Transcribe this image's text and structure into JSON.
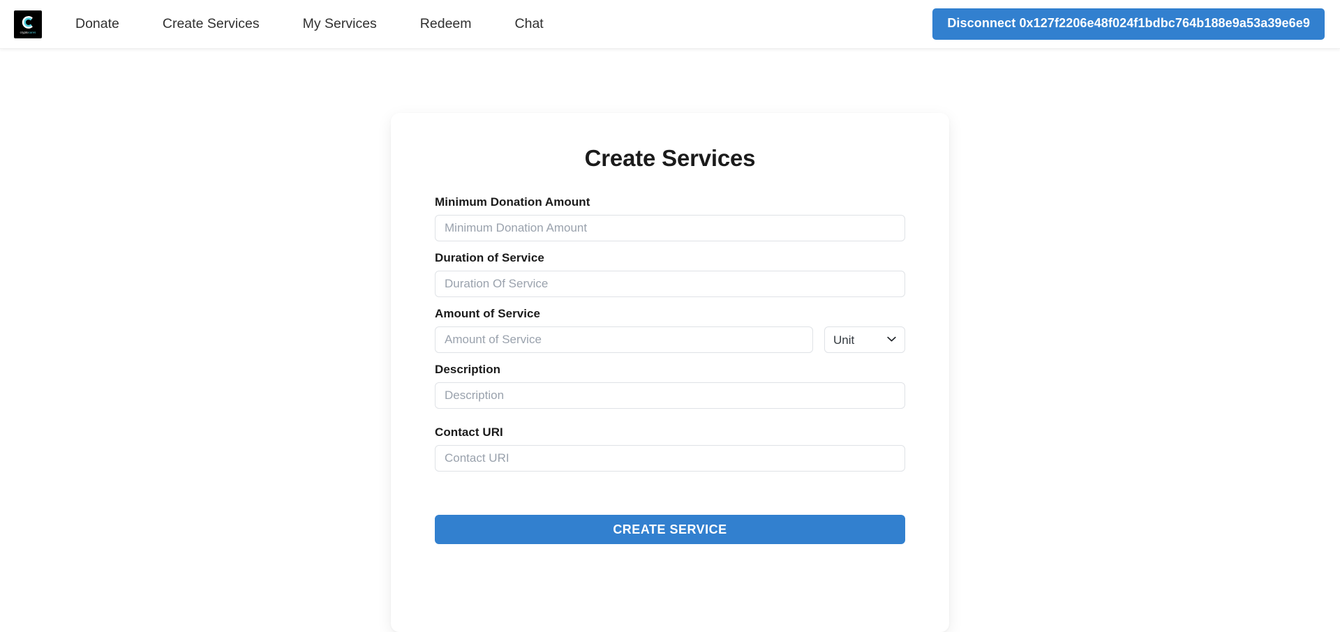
{
  "navbar": {
    "brand": {
      "icon": "crypto-c-logo-icon",
      "wordmark_primary": "crypto",
      "wordmark_accent": "cares"
    },
    "links": [
      {
        "label": "Donate",
        "name": "nav-link-donate"
      },
      {
        "label": "Create Services",
        "name": "nav-link-create-services"
      },
      {
        "label": "My Services",
        "name": "nav-link-my-services"
      },
      {
        "label": "Redeem",
        "name": "nav-link-redeem"
      },
      {
        "label": "Chat",
        "name": "nav-link-chat"
      }
    ],
    "disconnect_label": "Disconnect 0x127f2206e48f024f1bdbc764b188e9a53a39e6e9",
    "accent_color": "#3280cf"
  },
  "card": {
    "title": "Create Services",
    "fields": {
      "min_donation": {
        "label": "Minimum Donation Amount",
        "placeholder": "Minimum Donation Amount",
        "value": ""
      },
      "duration": {
        "label": "Duration of Service",
        "placeholder": "Duration Of Service",
        "value": ""
      },
      "amount": {
        "label": "Amount of Service",
        "placeholder": "Amount of Service",
        "value": ""
      },
      "unit": {
        "selected": "Unit",
        "options": [
          "Unit"
        ],
        "chevron_icon": "chevron-down-icon"
      },
      "description": {
        "label": "Description",
        "placeholder": "Description",
        "value": ""
      },
      "contact_uri": {
        "label": "Contact URI",
        "placeholder": "Contact URI",
        "value": ""
      }
    },
    "submit_label": "CREATE SERVICE"
  },
  "theme": {
    "accent": "#3280cf",
    "page_background": "#ffffff",
    "card_background": "#ffffff",
    "input_border": "#dfe2e6",
    "placeholder_color": "#9aa2ad",
    "text_color": "#1b1b1b"
  }
}
